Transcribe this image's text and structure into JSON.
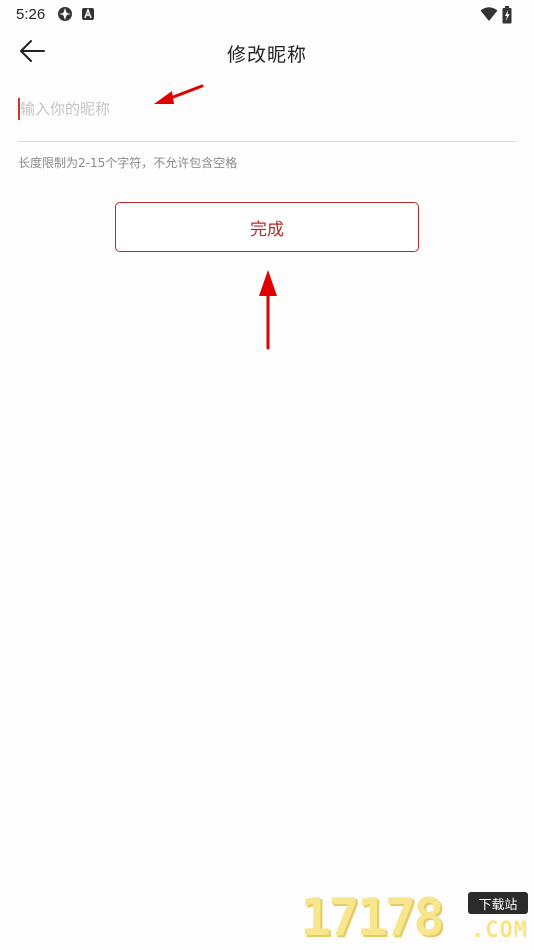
{
  "status_bar": {
    "time": "5:26",
    "icons_left": [
      "app-notification-icon",
      "a-notification-icon"
    ],
    "icons_right": [
      "wifi-icon",
      "battery-charging-icon"
    ]
  },
  "header": {
    "title": "修改昵称",
    "back_icon": "arrow-left-icon"
  },
  "nickname_input": {
    "value": "",
    "placeholder": "输入你的昵称"
  },
  "hint": "长度限制为2-15个字符，不允许包含空格",
  "done_button": {
    "label": "完成"
  },
  "colors": {
    "accent": "#b8292a",
    "annotation_arrow": "#e00000",
    "hint": "#8a8a8a",
    "placeholder": "#c4c4c4"
  },
  "watermark": {
    "digits": "17178",
    "badge": "下载站",
    "domain": ".COM"
  }
}
